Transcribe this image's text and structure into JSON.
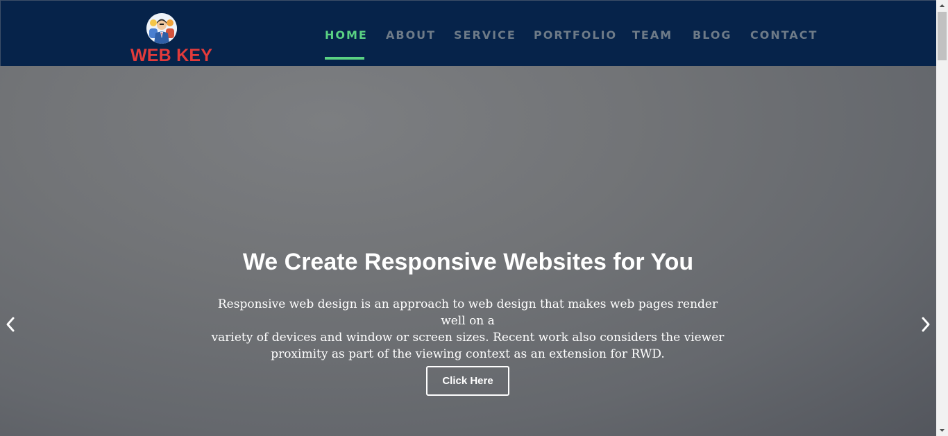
{
  "brand": {
    "name": "WEB KEY",
    "logo_icon": "team-avatar-icon",
    "colors": {
      "name": "#e23b3b",
      "navbar": "#06234a",
      "active": "#5ad283"
    }
  },
  "nav": {
    "items": [
      {
        "label": "HOME",
        "active": true
      },
      {
        "label": "ABOUT",
        "active": false
      },
      {
        "label": "SERVICE",
        "active": false
      },
      {
        "label": "PORTFOLIO",
        "active": false
      },
      {
        "label": "TEAM",
        "active": false
      },
      {
        "label": "BLOG",
        "active": false
      },
      {
        "label": "CONTACT",
        "active": false
      }
    ]
  },
  "hero": {
    "title": "We Create Responsive Websites for You",
    "lines": [
      "Responsive web design is an approach to web design that makes web pages render well on a",
      "variety of devices and window or screen sizes. Recent work also considers the viewer",
      "proximity as part of the viewing context as an extension for RWD."
    ],
    "button_label": "Click Here",
    "prev_icon": "chevron-left-icon",
    "next_icon": "chevron-right-icon"
  }
}
